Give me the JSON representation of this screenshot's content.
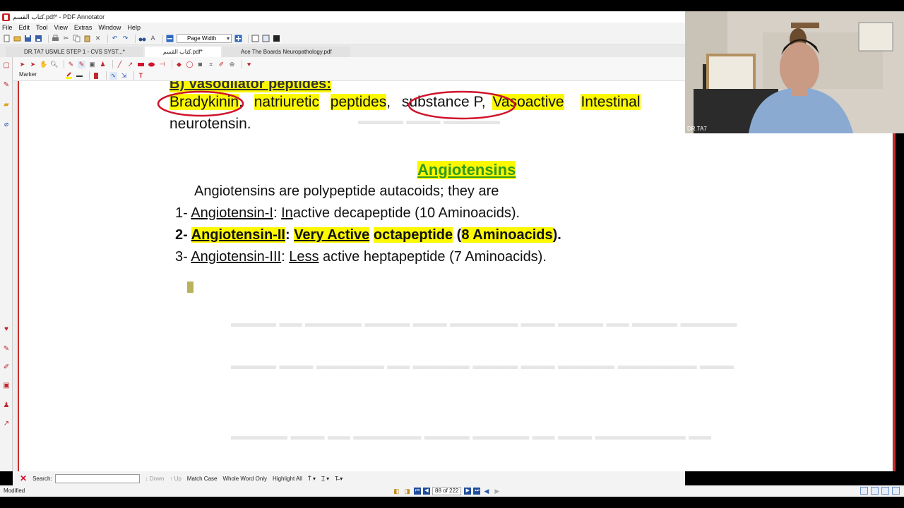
{
  "window": {
    "title": "كتاب القسم.pdf* - PDF Annotator"
  },
  "menu": [
    "File",
    "Edit",
    "Tool",
    "View",
    "Extras",
    "Window",
    "Help"
  ],
  "toolbar": {
    "zoom_value": "Page Width"
  },
  "tabs": [
    {
      "label": "DR.TA7 USMLE STEP 1 - CVS SYST...*",
      "active": false
    },
    {
      "label": "كتاب القسم.pdf*",
      "active": true
    },
    {
      "label": "Ace The Boards Neuropathology.pdf",
      "active": false
    }
  ],
  "annotation_toolbar": {
    "tool_label": "Marker"
  },
  "document": {
    "section_heading": "B) Vasodilator peptides:",
    "peptides_line1": [
      "Bradykinin",
      ",",
      "natriuretic",
      "peptides",
      ",",
      "substance P,",
      "Vasoactive",
      "Intestinal"
    ],
    "peptides_line2": "neurotensin.",
    "title": "Angiotensins",
    "intro": "Angiotensins are polypeptide autacoids; they are",
    "items": [
      {
        "num": "1-",
        "name": "Angiotensin-I",
        "sep": ":",
        "first_letter": "In",
        "rest": "active decapeptide (10 Aminoacids)."
      },
      {
        "num": "2-",
        "name": "Angiotensin-II",
        "sep": ":",
        "p1": "Very Active",
        "p2": "octapeptide",
        "p3": "(",
        "p4": "8 Aminoacids",
        "p5": ")."
      },
      {
        "num": "3-",
        "name": "Angiotensin-III",
        "sep": ":",
        "first_letter": "Less",
        "rest": "active heptapeptide (7 Aminoacids)."
      }
    ]
  },
  "findbar": {
    "label": "Search:",
    "down": "Down",
    "up": "Up",
    "match_case": "Match Case",
    "whole_word": "Whole Word Only",
    "highlight_all": "Highlight All"
  },
  "status": {
    "state": "Modified",
    "page_indicator": "88 of 222"
  },
  "webcam": {
    "label": "DR.TA7"
  },
  "colors": {
    "highlight": "#fbf800",
    "title_green": "#2f9a1e",
    "red_ink": "#d0142c"
  }
}
